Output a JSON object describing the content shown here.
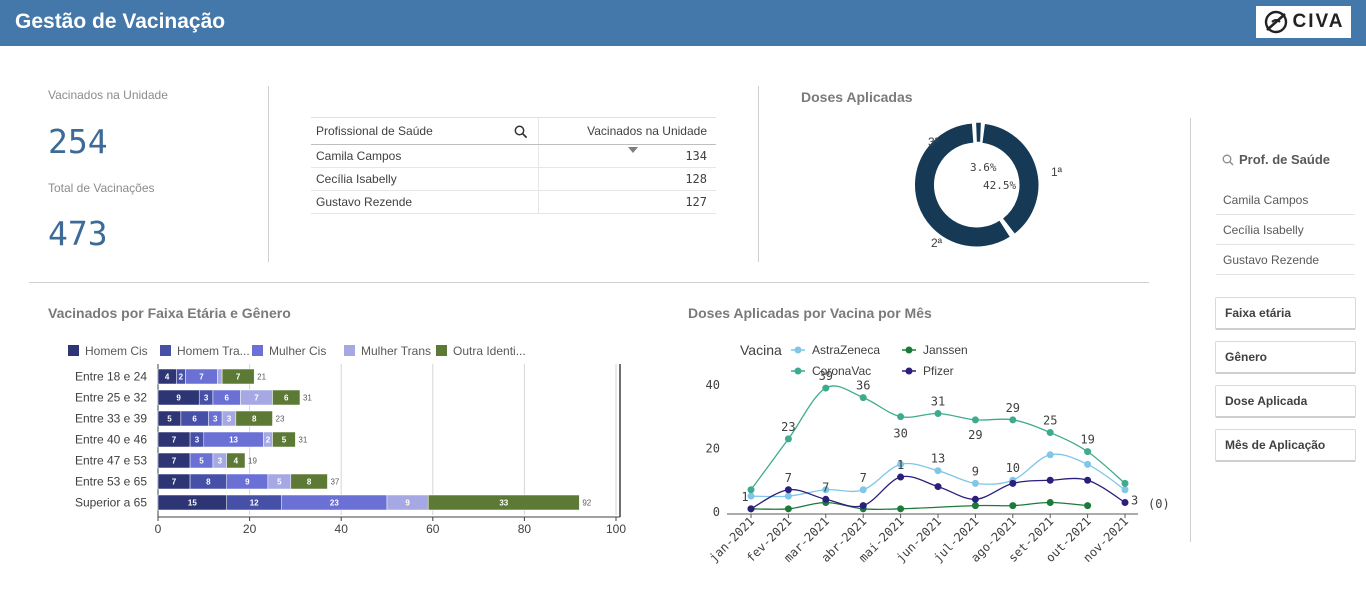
{
  "header": {
    "title": "Gestão de Vacinação",
    "logo_text": "CIVA"
  },
  "kpis": [
    {
      "label": "Vacinados na Unidade",
      "value": "254"
    },
    {
      "label": "Total de Vacinações",
      "value": "473"
    }
  ],
  "prof_table": {
    "columns": [
      "Profissional de Saúde",
      "Vacinados na Unidade"
    ],
    "rows": [
      {
        "name": "Camila Campos",
        "value": "134"
      },
      {
        "name": "Cecília Isabelly",
        "value": "128"
      },
      {
        "name": "Gustavo Rezende",
        "value": "127"
      }
    ]
  },
  "donut": {
    "title": "Doses Aplicadas",
    "labels": {
      "d1": "1ª",
      "d2": "2ª",
      "d3": "3ª"
    },
    "pct_a": "3.6%",
    "pct_b": "42.5%"
  },
  "filter": {
    "title": "Prof. de Saúde",
    "items": [
      "Camila Campos",
      "Cecília Isabelly",
      "Gustavo Rezende"
    ],
    "facets": [
      "Faixa etária",
      "Gênero",
      "Dose Aplicada",
      "Mês de Aplicação"
    ]
  },
  "colors": {
    "header": "#4477aa",
    "homem_cis": "#2e3575",
    "homem_trans": "#4650a6",
    "mulher_cis": "#6b70d4",
    "mulher_trans": "#a5a8e3",
    "outra": "#5c7a35",
    "astrazeneca": "#7fc6e8",
    "coronavac": "#3eaa8e",
    "janssen": "#1d7a3a",
    "pfizer": "#2a1f7a",
    "donut": "#163a56"
  },
  "chart_data": [
    {
      "type": "bar",
      "title": "Vacinados por Faixa Etária e Gênero",
      "orientation": "horizontal",
      "stacked": true,
      "categories": [
        "Entre 18 e 24",
        "Entre 25 e 32",
        "Entre 33 e 39",
        "Entre 40 e 46",
        "Entre 47 e 53",
        "Entre 53 e 65",
        "Superior a 65"
      ],
      "series": [
        {
          "name": "Homem Cis",
          "values": [
            4,
            9,
            5,
            7,
            7,
            7,
            15
          ]
        },
        {
          "name": "Homem Tra...",
          "values": [
            2,
            3,
            6,
            3,
            0,
            8,
            12
          ]
        },
        {
          "name": "Mulher Cis",
          "values": [
            7,
            6,
            3,
            13,
            5,
            9,
            23
          ]
        },
        {
          "name": "Mulher Trans",
          "values": [
            1,
            7,
            3,
            2,
            3,
            5,
            9
          ]
        },
        {
          "name": "Outra Identi...",
          "values": [
            7,
            6,
            8,
            5,
            4,
            8,
            33
          ]
        }
      ],
      "totals": [
        21,
        31,
        23,
        31,
        19,
        37,
        92
      ],
      "xlim": [
        0,
        100
      ],
      "xticks": [
        0,
        20,
        40,
        60,
        80,
        100
      ],
      "legend": "top",
      "grid": true
    },
    {
      "type": "line",
      "title": "Doses Aplicadas por Vacina por Mês",
      "legend_title": "Vacina",
      "legend": "top",
      "x": [
        "jan-2021",
        "fev-2021",
        "mar-2021",
        "abr-2021",
        "mai-2021",
        "jun-2021",
        "jul-2021",
        "ago-2021",
        "set-2021",
        "out-2021",
        "nov-2021"
      ],
      "series": [
        {
          "name": "AstraZeneca",
          "values": [
            5,
            5,
            7,
            7,
            15,
            13,
            9,
            10,
            18,
            15,
            7
          ]
        },
        {
          "name": "CoronaVac",
          "values": [
            7,
            23,
            39,
            36,
            30,
            31,
            29,
            29,
            25,
            19,
            9
          ]
        },
        {
          "name": "Janssen",
          "values": [
            1,
            1,
            3,
            1,
            1,
            null,
            2,
            2,
            3,
            2,
            null
          ]
        },
        {
          "name": "Pfizer",
          "values": [
            1,
            7,
            4,
            2,
            11,
            8,
            4,
            9,
            10,
            10,
            3
          ]
        }
      ],
      "data_labels": [
        {
          "x": "jan-2021",
          "text": "1"
        },
        {
          "x": "fev-2021",
          "text": "23"
        },
        {
          "x": "fev-2021",
          "text": "7"
        },
        {
          "x": "mar-2021",
          "text": "39"
        },
        {
          "x": "mar-2021",
          "text": "7"
        },
        {
          "x": "abr-2021",
          "text": "36"
        },
        {
          "x": "abr-2021",
          "text": "7"
        },
        {
          "x": "mai-2021",
          "text": "30"
        },
        {
          "x": "mai-2021",
          "text": "1"
        },
        {
          "x": "jun-2021",
          "text": "31"
        },
        {
          "x": "jun-2021",
          "text": "13"
        },
        {
          "x": "jul-2021",
          "text": "29"
        },
        {
          "x": "jul-2021",
          "text": "9"
        },
        {
          "x": "ago-2021",
          "text": "29"
        },
        {
          "x": "ago-2021",
          "text": "10"
        },
        {
          "x": "set-2021",
          "text": "25"
        },
        {
          "x": "out-2021",
          "text": "19"
        },
        {
          "x": "nov-2021",
          "text": "3"
        }
      ],
      "ylim": [
        0,
        45
      ],
      "yticks": [
        0,
        20,
        40
      ],
      "null_label": "(0)",
      "grid": false
    }
  ]
}
